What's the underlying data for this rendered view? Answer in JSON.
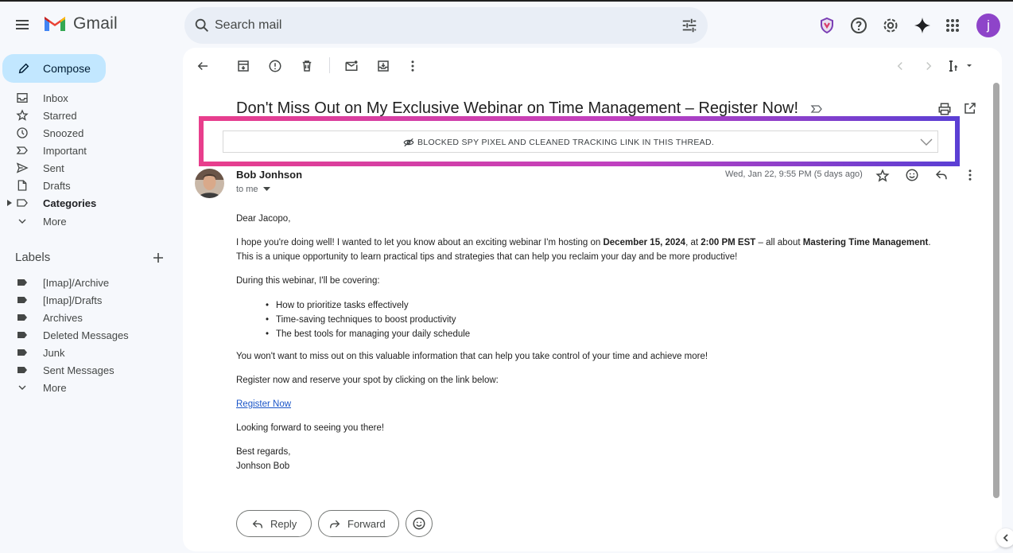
{
  "app": {
    "name": "Gmail",
    "avatar_letter": "j"
  },
  "search": {
    "placeholder": "Search mail"
  },
  "header_icons": [
    "shield-icon",
    "help-icon",
    "settings-icon",
    "gemini-sparkle-icon",
    "apps-grid-icon"
  ],
  "sidebar": {
    "compose_label": "Compose",
    "items": [
      {
        "label": "Inbox",
        "icon": "inbox-icon"
      },
      {
        "label": "Starred",
        "icon": "star-icon"
      },
      {
        "label": "Snoozed",
        "icon": "clock-icon"
      },
      {
        "label": "Important",
        "icon": "important-icon"
      },
      {
        "label": "Sent",
        "icon": "send-icon"
      },
      {
        "label": "Drafts",
        "icon": "draft-icon"
      },
      {
        "label": "Categories",
        "icon": "label-icon"
      },
      {
        "label": "More",
        "icon": "chevron-down-icon"
      }
    ],
    "labels_heading": "Labels",
    "labels": [
      {
        "label": "[Imap]/Archive"
      },
      {
        "label": "[Imap]/Drafts"
      },
      {
        "label": "Archives"
      },
      {
        "label": "Deleted Messages"
      },
      {
        "label": "Junk"
      },
      {
        "label": "Sent Messages"
      },
      {
        "label": "More"
      }
    ]
  },
  "email": {
    "subject": "Don't Miss Out on My Exclusive Webinar on Time Management – Register Now!",
    "banner": "BLOCKED SPY PIXEL AND CLEANED TRACKING LINK IN THIS THREAD.",
    "sender": "Bob Jonhson",
    "to": "to me",
    "date": "Wed, Jan 22, 9:55 PM (5 days ago)",
    "greeting": "Dear Jacopo,",
    "p1_a": "I hope you're doing well! I wanted to let you know about an exciting webinar I'm hosting on ",
    "p1_date": "December 15, 2024",
    "p1_b": ", at ",
    "p1_time": "2:00 PM EST",
    "p1_c": " – all about ",
    "p1_topic": "Mastering Time Management",
    "p1_d": ".",
    "p1_line2": "This is a unique opportunity to learn practical tips and strategies that can help you reclaim your day and be more productive!",
    "p2": "During this webinar, I'll be covering:",
    "bullets": [
      "How to prioritize tasks effectively",
      "Time-saving techniques to boost productivity",
      "The best tools for managing your daily schedule"
    ],
    "p3": "You won't want to miss out on this valuable information that can help you take control of your time and achieve more!",
    "p4": "Register now and reserve your spot by clicking on the link below:",
    "link": "Register Now",
    "p5": "Looking forward to seeing you there!",
    "signoff": "Best regards,",
    "signature": "Jonhson Bob"
  },
  "actions": {
    "reply": "Reply",
    "forward": "Forward"
  },
  "colors": {
    "compose_bg": "#c2e7ff",
    "search_bg": "#e9eef6",
    "avatar": "#8e44c9",
    "highlight_start": "#e83e8c",
    "highlight_end": "#5b3fd4",
    "link": "#1a55c8"
  }
}
